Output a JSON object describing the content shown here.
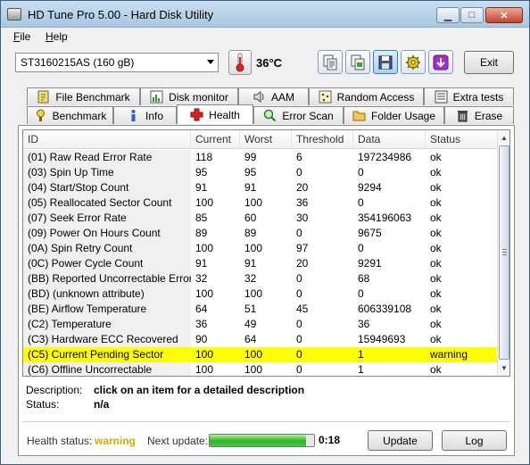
{
  "window": {
    "title": "HD Tune Pro 5.00 - Hard Disk Utility"
  },
  "menu": {
    "file": "File",
    "help": "Help"
  },
  "toolbar": {
    "drive": "ST3160215AS (160 gB)",
    "temperature": "36°C",
    "exit_label": "Exit",
    "icons": [
      "copy-text-icon",
      "copy-screenshot-icon",
      "save-icon",
      "settings-icon",
      "download-icon"
    ]
  },
  "tabs": {
    "top_row": [
      "File Benchmark",
      "Disk monitor",
      "AAM",
      "Random Access",
      "Extra tests"
    ],
    "bottom_row": [
      "Benchmark",
      "Info",
      "Health",
      "Error Scan",
      "Folder Usage",
      "Erase"
    ],
    "active": "Health"
  },
  "smart": {
    "columns": [
      "ID",
      "Current",
      "Worst",
      "Threshold",
      "Data",
      "Status"
    ],
    "rows": [
      [
        "(01) Raw Read Error Rate",
        "118",
        "99",
        "6",
        "197234986",
        "ok"
      ],
      [
        "(03) Spin Up Time",
        "95",
        "95",
        "0",
        "0",
        "ok"
      ],
      [
        "(04) Start/Stop Count",
        "91",
        "91",
        "20",
        "9294",
        "ok"
      ],
      [
        "(05) Reallocated Sector Count",
        "100",
        "100",
        "36",
        "0",
        "ok"
      ],
      [
        "(07) Seek Error Rate",
        "85",
        "60",
        "30",
        "354196063",
        "ok"
      ],
      [
        "(09) Power On Hours Count",
        "89",
        "89",
        "0",
        "9675",
        "ok"
      ],
      [
        "(0A) Spin Retry Count",
        "100",
        "100",
        "97",
        "0",
        "ok"
      ],
      [
        "(0C) Power Cycle Count",
        "91",
        "91",
        "20",
        "9291",
        "ok"
      ],
      [
        "(BB) Reported Uncorrectable Errors",
        "32",
        "32",
        "0",
        "68",
        "ok"
      ],
      [
        "(BD) (unknown attribute)",
        "100",
        "100",
        "0",
        "0",
        "ok"
      ],
      [
        "(BE) Airflow Temperature",
        "64",
        "51",
        "45",
        "606339108",
        "ok"
      ],
      [
        "(C2) Temperature",
        "36",
        "49",
        "0",
        "36",
        "ok"
      ],
      [
        "(C3) Hardware ECC Recovered",
        "90",
        "64",
        "0",
        "15949693",
        "ok"
      ],
      [
        "(C5) Current Pending Sector",
        "100",
        "100",
        "0",
        "1",
        "warning"
      ],
      [
        "(C6) Offline Uncorrectable",
        "100",
        "100",
        "0",
        "1",
        "ok"
      ]
    ],
    "highlight_color": "#ffff00"
  },
  "details": {
    "description_label": "Description:",
    "description_value": "click on an item for a detailed description",
    "status_label": "Status:",
    "status_value": "n/a"
  },
  "footer": {
    "health_label": "Health status:",
    "health_value": "warning",
    "health_color": "#d9a800",
    "next_update_label": "Next update:",
    "progress_percent": 92,
    "next_update_value": "0:18",
    "update_label": "Update",
    "log_label": "Log"
  }
}
